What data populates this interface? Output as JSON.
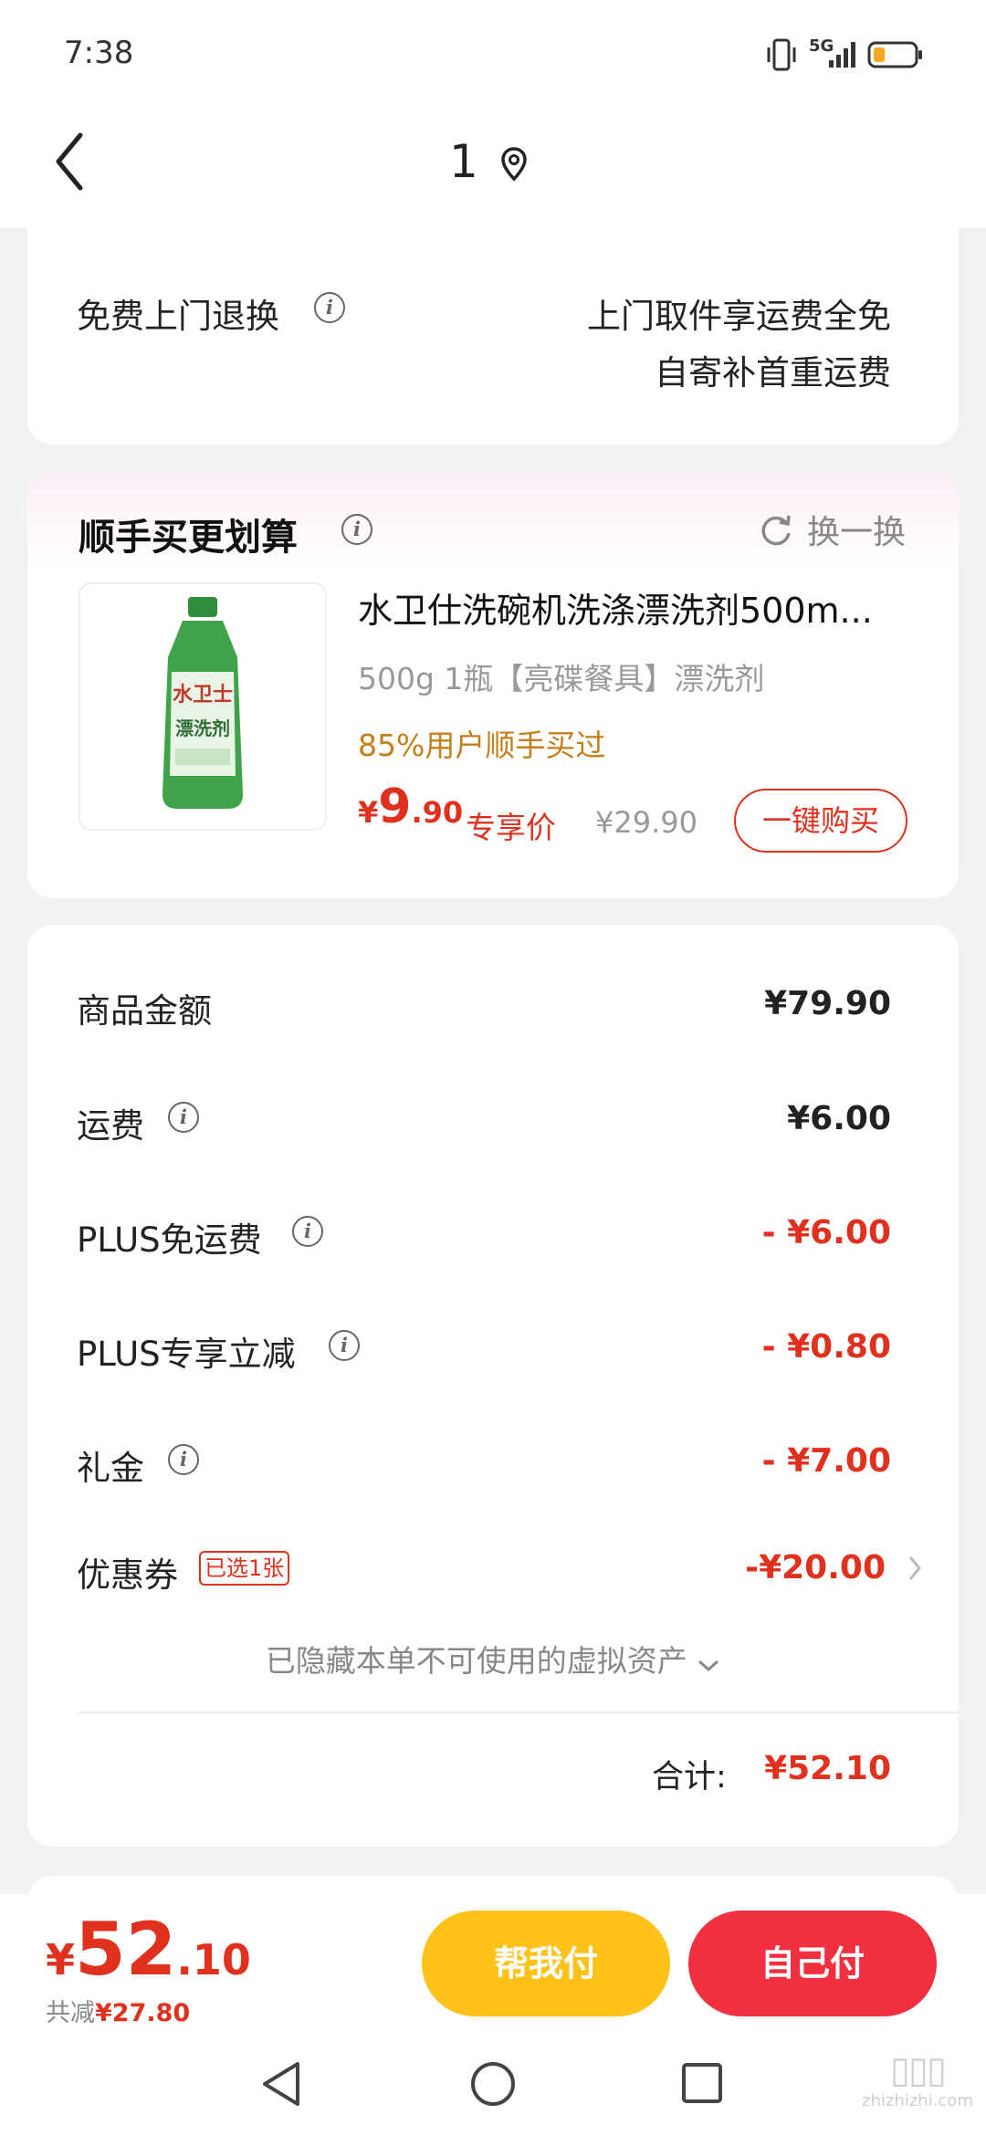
{
  "status_bar": {
    "time": "7:38",
    "network": "5G"
  },
  "header": {
    "title": "1"
  },
  "return_section": {
    "label": "免费上门退换",
    "line1": "上门取件享运费全免",
    "line2": "自寄补首重运费"
  },
  "recommend": {
    "title": "顺手买更划算",
    "refresh_label": "换一换",
    "product": {
      "name": "水卫仕洗碗机洗涤漂洗剂500m...",
      "spec": "500g 1瓶【亮碟餐具】漂洗剂",
      "social_proof": "85%用户顺手买过",
      "currency": "¥",
      "price_int": "9",
      "price_dec": ".90",
      "price_tag": "专享价",
      "original_price": "¥29.90",
      "buy_label": "一键购买"
    }
  },
  "summary": {
    "rows": [
      {
        "label": "商品金额",
        "value": "¥79.90"
      },
      {
        "label": "运费",
        "value": "¥6.00"
      },
      {
        "label": "PLUS免运费",
        "value": "- ¥6.00"
      },
      {
        "label": "PLUS专享立减",
        "value": "- ¥0.80"
      },
      {
        "label": "礼金",
        "value": "- ¥7.00"
      }
    ],
    "coupon": {
      "label": "优惠券",
      "badge": "已选1张",
      "value": "-¥20.00"
    },
    "hidden_assets": "已隐藏本单不可使用的虚拟资产",
    "total_label": "合计:",
    "total_value": "¥52.10"
  },
  "bottom": {
    "currency": "¥",
    "price_int": "52",
    "price_dec": ".10",
    "saved_label": "共减",
    "saved_value": "¥27.80",
    "help_pay_label": "帮我付",
    "self_pay_label": "自己付"
  },
  "colors": {
    "accent_red": "#e0301e",
    "orange_text": "#c47f1a",
    "help_pay_yellow": "#ffc21a",
    "self_pay_red": "#f0303f"
  },
  "watermark": "zhizhizhi.com"
}
